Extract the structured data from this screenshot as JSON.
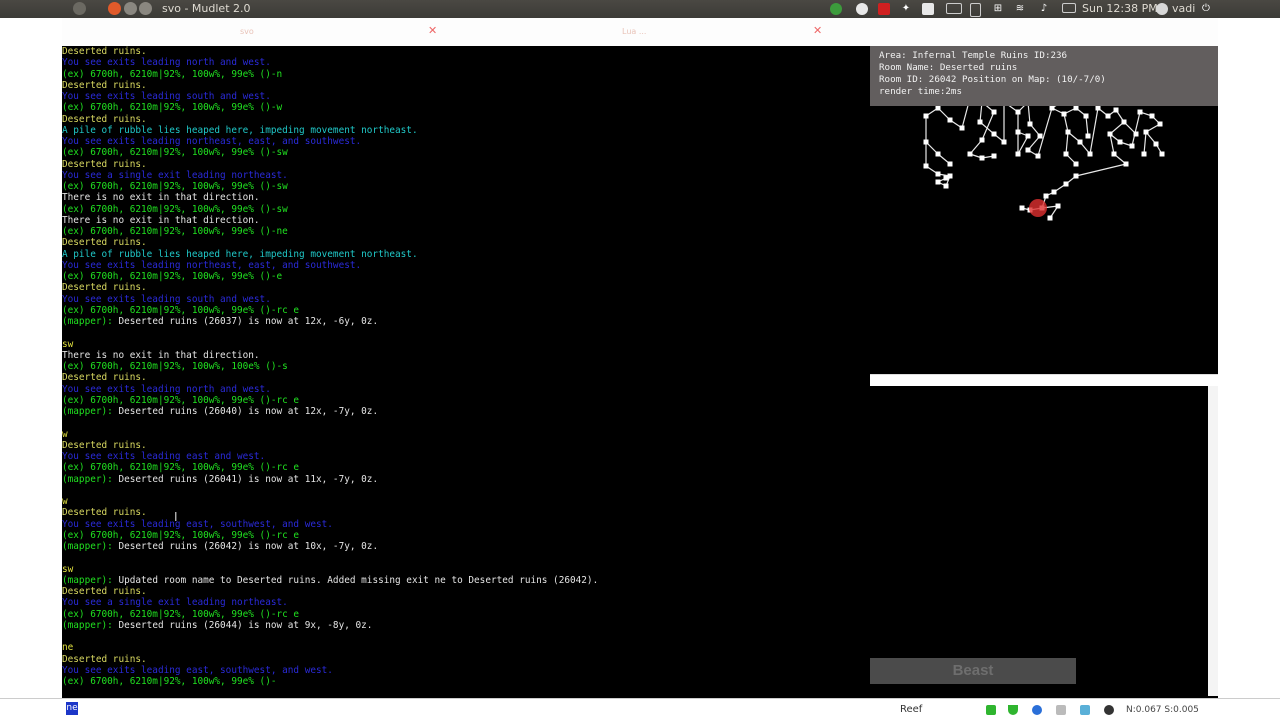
{
  "window": {
    "title": "svo - Mudlet 2.0",
    "clock": "Sun 12:38 PM",
    "user": "vadi"
  },
  "tabs": [
    {
      "label": "svo"
    },
    {
      "label": "Lua ..."
    }
  ],
  "console": {
    "lines": [
      {
        "text": "Deserted ruins.",
        "color": "c-y"
      },
      {
        "text": "You see exits leading north and west.",
        "color": "c-b"
      },
      {
        "text": "(ex) 6700h, 6210m|92%, 100w%, 99e% ()-n",
        "color": "c-g"
      },
      {
        "text": "Deserted ruins.",
        "color": "c-y"
      },
      {
        "text": "You see exits leading south and west.",
        "color": "c-b"
      },
      {
        "text": "(ex) 6700h, 6210m|92%, 100w%, 99e% ()-w",
        "color": "c-g"
      },
      {
        "text": "Deserted ruins.",
        "color": "c-y"
      },
      {
        "text": "A pile of rubble lies heaped here, impeding movement northeast.",
        "color": "c-c"
      },
      {
        "text": "You see exits leading northeast, east, and southwest.",
        "color": "c-b"
      },
      {
        "text": "(ex) 6700h, 6210m|92%, 100w%, 99e% ()-sw",
        "color": "c-g"
      },
      {
        "text": "Deserted ruins.",
        "color": "c-y"
      },
      {
        "text": "You see a single exit leading northeast.",
        "color": "c-b"
      },
      {
        "text": "(ex) 6700h, 6210m|92%, 100w%, 99e% ()-sw",
        "color": "c-g"
      },
      {
        "text": "There is no exit in that direction.",
        "color": "c-w"
      },
      {
        "text": "(ex) 6700h, 6210m|92%, 100w%, 99e% ()-sw",
        "color": "c-g"
      },
      {
        "text": "There is no exit in that direction.",
        "color": "c-w"
      },
      {
        "text": "(ex) 6700h, 6210m|92%, 100w%, 99e% ()-ne",
        "color": "c-g"
      },
      {
        "text": "Deserted ruins.",
        "color": "c-y"
      },
      {
        "text": "A pile of rubble lies heaped here, impeding movement northeast.",
        "color": "c-c"
      },
      {
        "text": "You see exits leading northeast, east, and southwest.",
        "color": "c-b"
      },
      {
        "text": "(ex) 6700h, 6210m|92%, 100w%, 99e% ()-e",
        "color": "c-g"
      },
      {
        "text": "Deserted ruins.",
        "color": "c-y"
      },
      {
        "text": "You see exits leading south and west.",
        "color": "c-b"
      },
      {
        "text": "(ex) 6700h, 6210m|92%, 100w%, 99e% ()-rc e",
        "color": "c-g"
      },
      {
        "text": "(mapper): Deserted ruins (26037) is now at 12x, -6y, 0z.",
        "color": "c-w",
        "prefix": "(mapper):"
      },
      {
        "text": "",
        "color": "c-w"
      },
      {
        "text": "sw",
        "color": "c-yl"
      },
      {
        "text": "There is no exit in that direction.",
        "color": "c-w"
      },
      {
        "text": "(ex) 6700h, 6210m|92%, 100w%, 100e% ()-s",
        "color": "c-g"
      },
      {
        "text": "Deserted ruins.",
        "color": "c-y"
      },
      {
        "text": "You see exits leading north and west.",
        "color": "c-b"
      },
      {
        "text": "(ex) 6700h, 6210m|92%, 100w%, 99e% ()-rc e",
        "color": "c-g"
      },
      {
        "text": "(mapper): Deserted ruins (26040) is now at 12x, -7y, 0z.",
        "color": "c-w",
        "prefix": "(mapper):"
      },
      {
        "text": "",
        "color": "c-w"
      },
      {
        "text": "w",
        "color": "c-yl"
      },
      {
        "text": "Deserted ruins.",
        "color": "c-y"
      },
      {
        "text": "You see exits leading east and west.",
        "color": "c-b"
      },
      {
        "text": "(ex) 6700h, 6210m|92%, 100w%, 99e% ()-rc e",
        "color": "c-g"
      },
      {
        "text": "(mapper): Deserted ruins (26041) is now at 11x, -7y, 0z.",
        "color": "c-w",
        "prefix": "(mapper):"
      },
      {
        "text": "",
        "color": "c-w"
      },
      {
        "text": "w",
        "color": "c-yl"
      },
      {
        "text": "Deserted ruins.",
        "color": "c-y"
      },
      {
        "text": "You see exits leading east, southwest, and west.",
        "color": "c-b"
      },
      {
        "text": "(ex) 6700h, 6210m|92%, 100w%, 99e% ()-rc e",
        "color": "c-g"
      },
      {
        "text": "(mapper): Deserted ruins (26042) is now at 10x, -7y, 0z.",
        "color": "c-w",
        "prefix": "(mapper):"
      },
      {
        "text": "",
        "color": "c-w"
      },
      {
        "text": "sw",
        "color": "c-yl"
      },
      {
        "text": "(mapper): Updated room name to Deserted ruins. Added missing exit ne to Deserted ruins (26042).",
        "color": "c-w",
        "prefix": "(mapper):"
      },
      {
        "text": "Deserted ruins.",
        "color": "c-y"
      },
      {
        "text": "You see a single exit leading northeast.",
        "color": "c-b"
      },
      {
        "text": "(ex) 6700h, 6210m|92%, 100w%, 99e% ()-rc e",
        "color": "c-g"
      },
      {
        "text": "(mapper): Deserted ruins (26044) is now at 9x, -8y, 0z.",
        "color": "c-w",
        "prefix": "(mapper):"
      },
      {
        "text": "",
        "color": "c-w"
      },
      {
        "text": "ne",
        "color": "c-yl"
      },
      {
        "text": "Deserted ruins.",
        "color": "c-y"
      },
      {
        "text": "You see exits leading east, southwest, and west.",
        "color": "c-b"
      },
      {
        "text": "(ex) 6700h, 6210m|92%, 100w%, 99e% ()-",
        "color": "c-g"
      }
    ]
  },
  "mapper": {
    "area": "Area: Infernal Temple Ruins ID:236",
    "room_name": "Room Name: Deserted ruins",
    "room_id": "Room ID: 26042 Position on Map: (10/-7/0)",
    "render_time": "render time:2ms"
  },
  "panels": {
    "beast_label": "Beast"
  },
  "bottombar": {
    "command": "ne",
    "profile": "Reef",
    "net_stats": "N:0.067 S:0.005"
  },
  "colors": {
    "exits_blue": "#2a2ad8",
    "prompt_green": "#20e020",
    "room_yellow": "#d8d860",
    "map_info_bg": "#625e5e",
    "player_marker": "#e03030"
  }
}
